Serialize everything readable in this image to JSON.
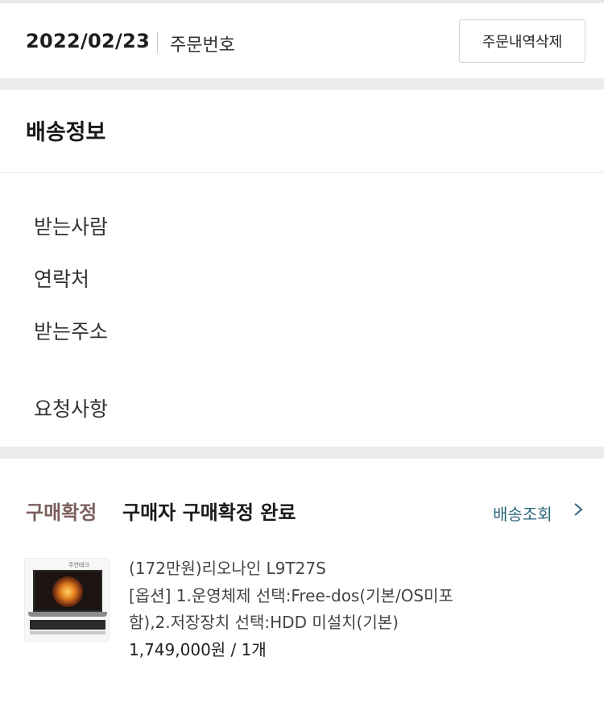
{
  "order": {
    "date": "2022/02/23",
    "number_label": "주문번호",
    "delete_label": "주문내역삭제"
  },
  "shipping": {
    "title": "배송정보",
    "recipient_label": "받는사람",
    "contact_label": "연락처",
    "address_label": "받는주소",
    "request_label": "요청사항"
  },
  "purchase": {
    "status_label": "구매확정",
    "status_text": "구매자 구매확정 완료",
    "tracking_label": "배송조회"
  },
  "product": {
    "name": "(172만원)리오나인 L9T27S",
    "option_line1": "[옵션] 1.운영체제 선택:Free-dos(기본/OS미포",
    "option_line2": "함),2.저장장치 선택:HDD 미설치(기본)",
    "price_qty": "1,749,000원 / 1개",
    "thumb_brand": "주연테크"
  },
  "colors": {
    "status_label": "#7b5f5b",
    "tracking_link": "#2f6a7c",
    "section_band": "#ececec"
  },
  "icons": {
    "tracking_chevron": "chevron-right-icon",
    "product_image": "laptop-product-image"
  }
}
